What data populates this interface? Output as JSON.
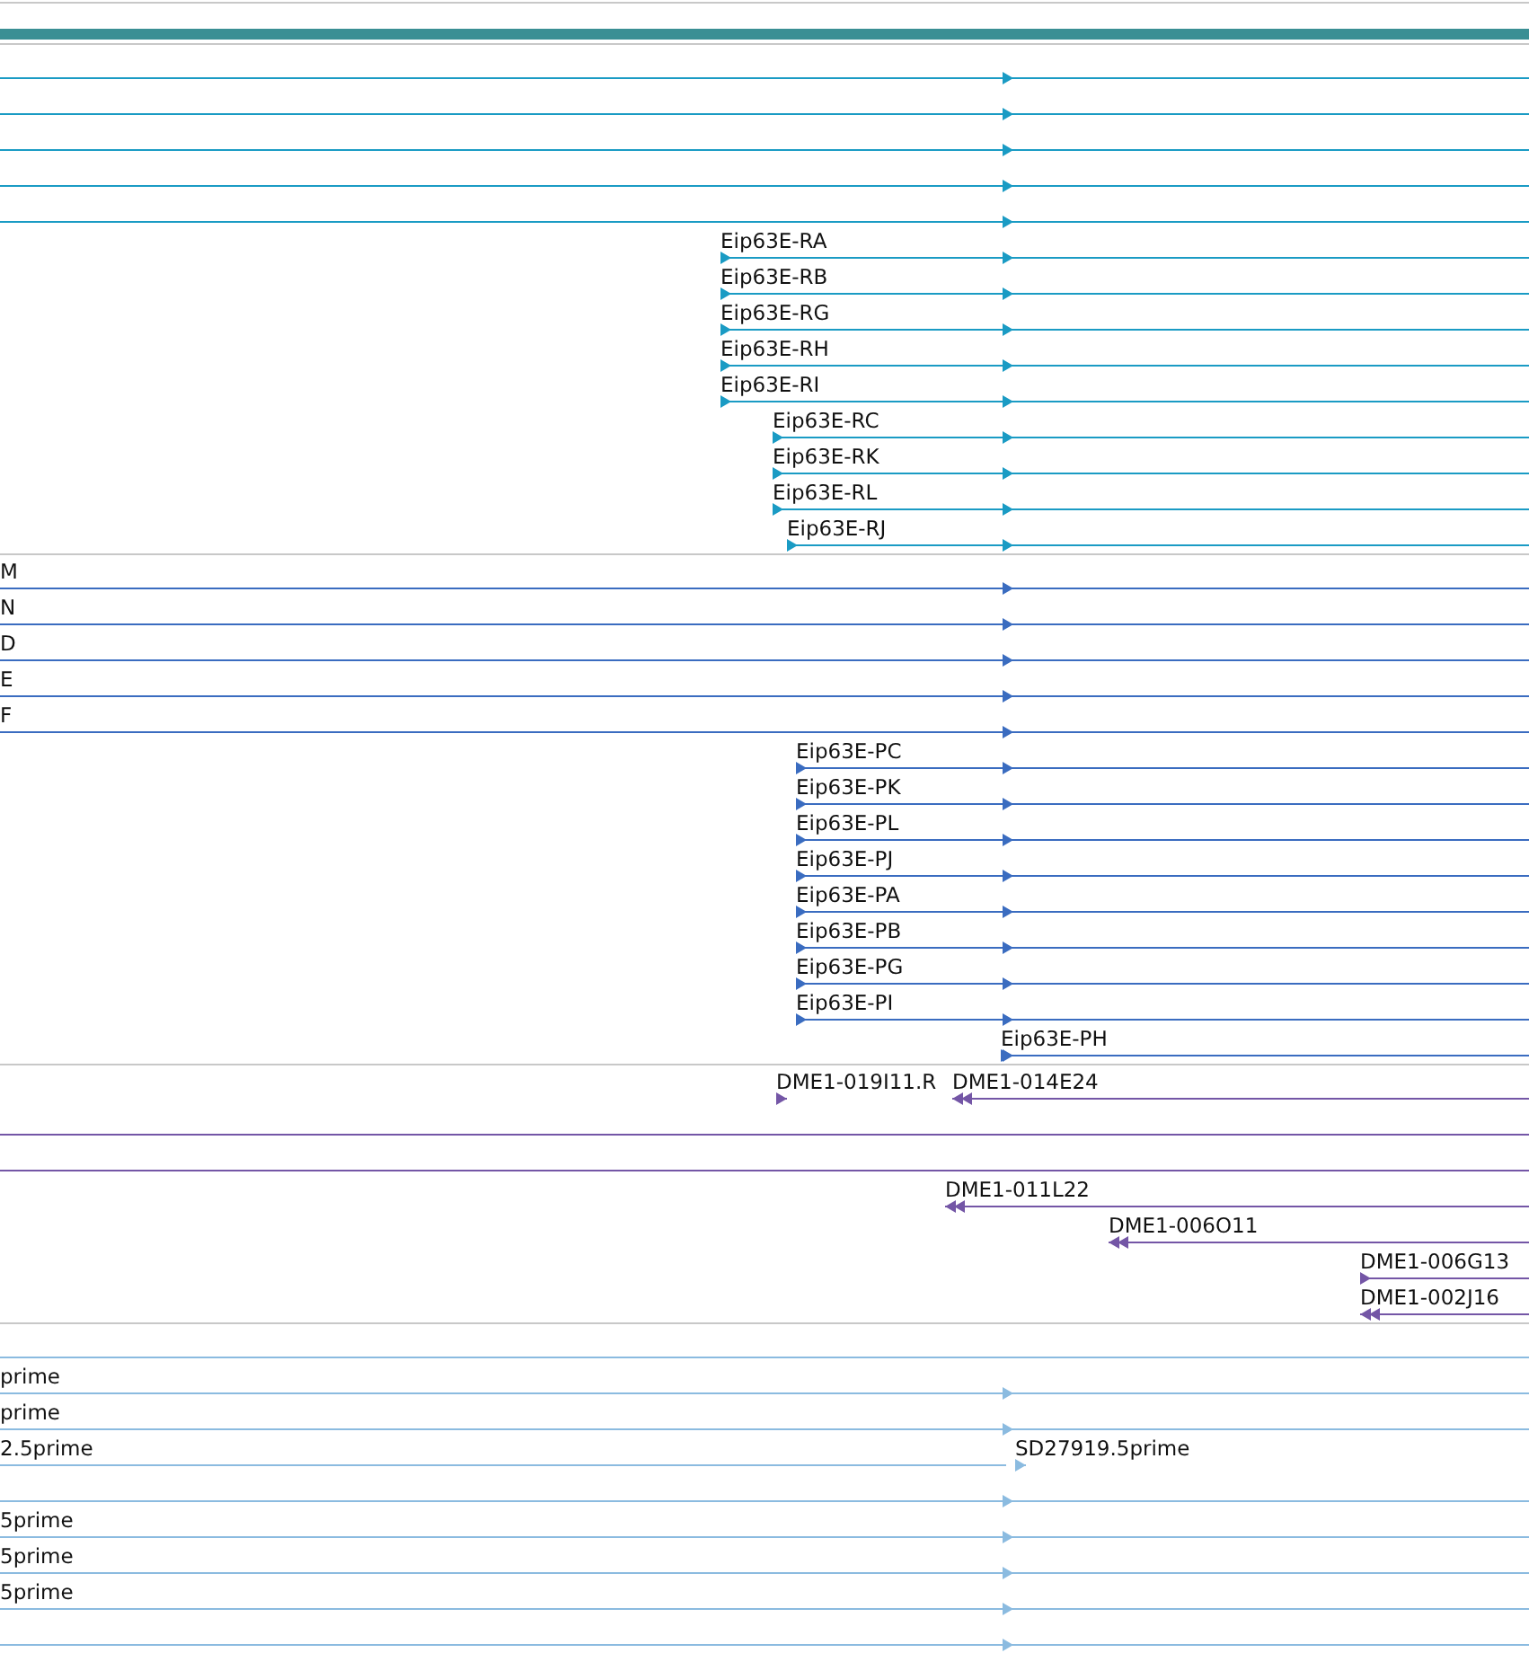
{
  "tracks": [
    {
      "color": "#1a9bc4",
      "rows": [
        {
          "features": [
            {
              "kind": "forward"
            }
          ]
        },
        {
          "features": [
            {
              "kind": "forward"
            }
          ]
        },
        {
          "features": [
            {
              "kind": "forward"
            }
          ]
        },
        {
          "features": [
            {
              "kind": "forward"
            }
          ]
        },
        {
          "features": [
            {
              "kind": "forward"
            }
          ]
        },
        {
          "features": [
            {
              "label": "Eip63E-RA",
              "kind": "forward"
            }
          ]
        },
        {
          "features": [
            {
              "label": "Eip63E-RB",
              "kind": "forward"
            }
          ]
        },
        {
          "features": [
            {
              "label": "Eip63E-RG",
              "kind": "forward"
            }
          ]
        },
        {
          "features": [
            {
              "label": "Eip63E-RH",
              "kind": "forward"
            }
          ]
        },
        {
          "features": [
            {
              "label": "Eip63E-RI",
              "kind": "forward"
            }
          ]
        },
        {
          "features": [
            {
              "label": "Eip63E-RC",
              "kind": "forward"
            }
          ]
        },
        {
          "features": [
            {
              "label": "Eip63E-RK",
              "kind": "forward"
            }
          ]
        },
        {
          "features": [
            {
              "label": "Eip63E-RL",
              "kind": "forward"
            }
          ]
        },
        {
          "features": [
            {
              "label": "Eip63E-RJ",
              "kind": "forward"
            }
          ]
        }
      ]
    },
    {
      "color": "#3a6cc0",
      "rows": [
        {
          "features": [
            {
              "label": "M",
              "kind": "forward"
            }
          ]
        },
        {
          "features": [
            {
              "label": "N",
              "kind": "forward"
            }
          ]
        },
        {
          "features": [
            {
              "label": "D",
              "kind": "forward"
            }
          ]
        },
        {
          "features": [
            {
              "label": "E",
              "kind": "forward"
            }
          ]
        },
        {
          "features": [
            {
              "label": "F",
              "kind": "forward"
            }
          ]
        },
        {
          "features": [
            {
              "label": "Eip63E-PC",
              "kind": "forward"
            }
          ]
        },
        {
          "features": [
            {
              "label": "Eip63E-PK",
              "kind": "forward"
            }
          ]
        },
        {
          "features": [
            {
              "label": "Eip63E-PL",
              "kind": "forward"
            }
          ]
        },
        {
          "features": [
            {
              "label": "Eip63E-PJ",
              "kind": "forward"
            }
          ]
        },
        {
          "features": [
            {
              "label": "Eip63E-PA",
              "kind": "forward"
            }
          ]
        },
        {
          "features": [
            {
              "label": "Eip63E-PB",
              "kind": "forward"
            }
          ]
        },
        {
          "features": [
            {
              "label": "Eip63E-PG",
              "kind": "forward"
            }
          ]
        },
        {
          "features": [
            {
              "label": "Eip63E-PI",
              "kind": "forward"
            }
          ]
        },
        {
          "features": [
            {
              "label": "Eip63E-PH",
              "kind": "forward"
            }
          ]
        }
      ]
    },
    {
      "color": "#7456a6",
      "rows": [
        {
          "features": [
            {
              "label": "DME1-019I11.R",
              "kind": "forward"
            },
            {
              "label": "DME1-014E24",
              "kind": "reverse"
            }
          ]
        },
        {
          "features": [
            {
              "kind": "plain"
            }
          ]
        },
        {
          "features": [
            {
              "kind": "plain"
            }
          ]
        },
        {
          "features": [
            {
              "label": "DME1-011L22",
              "kind": "reverse"
            }
          ]
        },
        {
          "features": [
            {
              "label": "DME1-006O11",
              "kind": "reverse"
            }
          ]
        },
        {
          "features": [
            {
              "label": "DME1-006G13",
              "kind": "forward"
            }
          ]
        },
        {
          "features": [
            {
              "label": "DME1-002J16",
              "kind": "reverse"
            }
          ]
        }
      ]
    },
    {
      "color": "#8bbbe0",
      "rows": [
        {
          "features": [
            {
              "kind": "plain"
            }
          ]
        },
        {
          "features": [
            {
              "label": "prime",
              "kind": "forward"
            }
          ]
        },
        {
          "features": [
            {
              "label": "prime",
              "kind": "forward"
            }
          ]
        },
        {
          "features": [
            {
              "label": "2.5prime",
              "kind": "forward"
            },
            {
              "label": "SD27919.5prime",
              "kind": "forward"
            }
          ]
        },
        {
          "features": [
            {
              "kind": "forward"
            }
          ]
        },
        {
          "features": [
            {
              "label": "5prime",
              "kind": "forward"
            }
          ]
        },
        {
          "features": [
            {
              "label": "5prime",
              "kind": "forward"
            }
          ]
        },
        {
          "features": [
            {
              "label": "5prime",
              "kind": "forward"
            }
          ]
        },
        {
          "features": [
            {
              "kind": "forward"
            }
          ]
        }
      ]
    }
  ]
}
